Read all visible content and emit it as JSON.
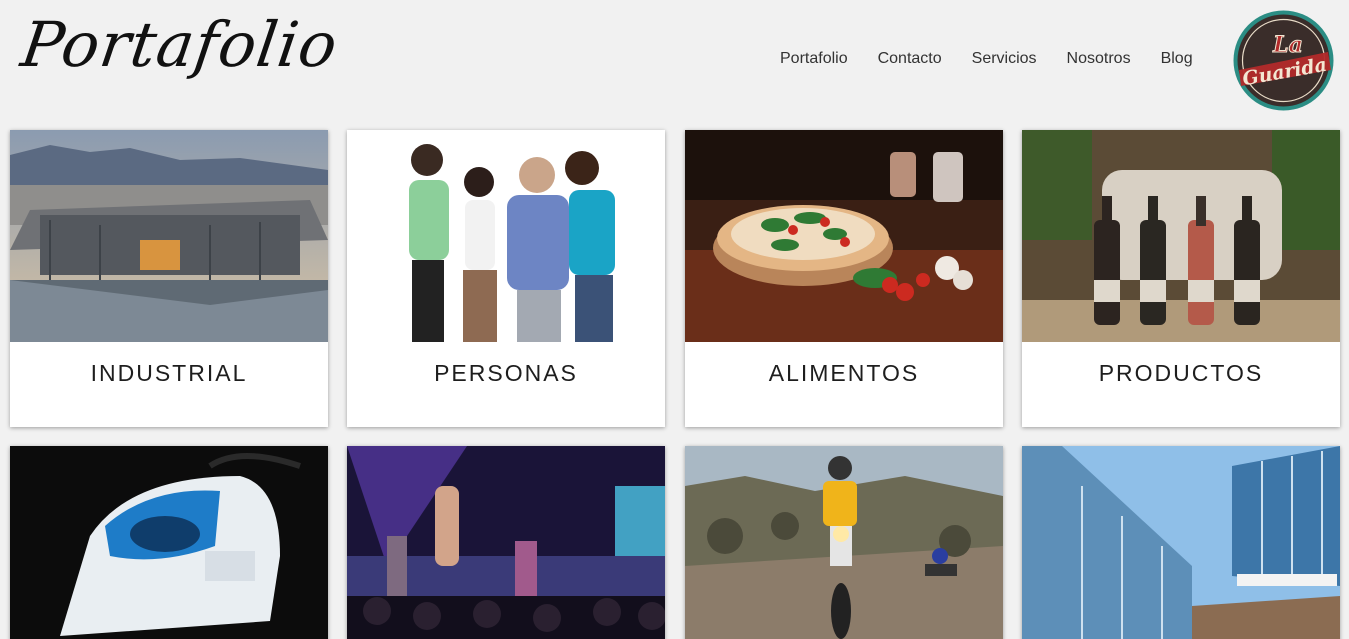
{
  "header": {
    "logo_text": "Portafolio",
    "badge_line1": "La",
    "badge_line2": "Guarida"
  },
  "nav": {
    "items": [
      "Portafolio",
      "Contacto",
      "Servicios",
      "Nosotros",
      "Blog"
    ]
  },
  "cards_row1": [
    {
      "label": "INDUSTRIAL",
      "image": "industrial-plant-image"
    },
    {
      "label": "PERSONAS",
      "image": "people-group-image"
    },
    {
      "label": "ALIMENTOS",
      "image": "pizza-image"
    },
    {
      "label": "PRODUCTOS",
      "image": "wine-bottles-image"
    }
  ],
  "cards_row2": [
    {
      "image": "steam-iron-image"
    },
    {
      "image": "concert-image"
    },
    {
      "image": "motocross-image"
    },
    {
      "image": "building-pool-image"
    }
  ]
}
